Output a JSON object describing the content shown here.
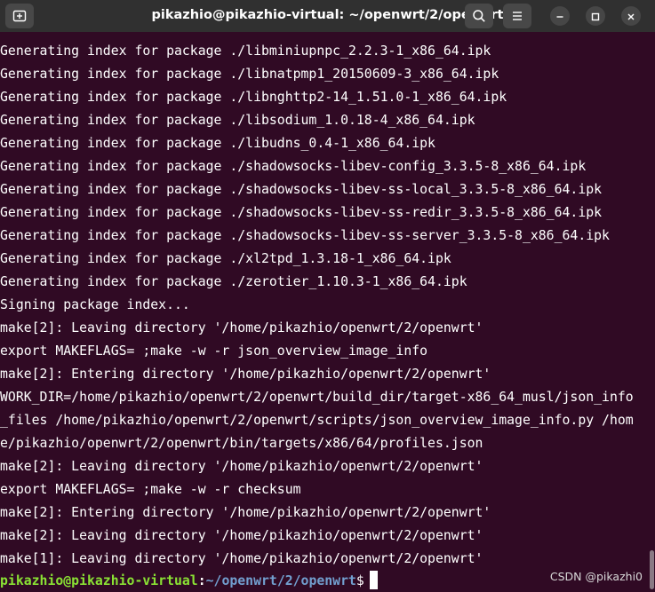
{
  "window": {
    "title": "pikazhio@pikazhio-virtual: ~/openwrt/2/openwrt"
  },
  "toolbar": {
    "new_tab_icon": "new-tab-icon",
    "search_icon": "search-icon",
    "menu_icon": "hamburger-menu-icon"
  },
  "window_controls": {
    "minimize_icon": "minimize-icon",
    "maximize_icon": "maximize-icon",
    "close_icon": "close-icon"
  },
  "terminal": {
    "lines": [
      "Generating index for package ./libminiupnpc_2.2.3-1_x86_64.ipk",
      "Generating index for package ./libnatpmp1_20150609-3_x86_64.ipk",
      "Generating index for package ./libnghttp2-14_1.51.0-1_x86_64.ipk",
      "Generating index for package ./libsodium_1.0.18-4_x86_64.ipk",
      "Generating index for package ./libudns_0.4-1_x86_64.ipk",
      "Generating index for package ./shadowsocks-libev-config_3.3.5-8_x86_64.ipk",
      "Generating index for package ./shadowsocks-libev-ss-local_3.3.5-8_x86_64.ipk",
      "Generating index for package ./shadowsocks-libev-ss-redir_3.3.5-8_x86_64.ipk",
      "Generating index for package ./shadowsocks-libev-ss-server_3.3.5-8_x86_64.ipk",
      "Generating index for package ./xl2tpd_1.3.18-1_x86_64.ipk",
      "Generating index for package ./zerotier_1.10.3-1_x86_64.ipk",
      "Signing package index...",
      "make[2]: Leaving directory '/home/pikazhio/openwrt/2/openwrt'",
      "export MAKEFLAGS= ;make -w -r json_overview_image_info",
      "make[2]: Entering directory '/home/pikazhio/openwrt/2/openwrt'",
      "WORK_DIR=/home/pikazhio/openwrt/2/openwrt/build_dir/target-x86_64_musl/json_info",
      "_files /home/pikazhio/openwrt/2/openwrt/scripts/json_overview_image_info.py /hom",
      "e/pikazhio/openwrt/2/openwrt/bin/targets/x86/64/profiles.json",
      "make[2]: Leaving directory '/home/pikazhio/openwrt/2/openwrt'",
      "export MAKEFLAGS= ;make -w -r checksum",
      "make[2]: Entering directory '/home/pikazhio/openwrt/2/openwrt'",
      "make[2]: Leaving directory '/home/pikazhio/openwrt/2/openwrt'",
      "make[1]: Leaving directory '/home/pikazhio/openwrt/2/openwrt'"
    ],
    "prompt": {
      "user_host": "pikazhio@pikazhio-virtual",
      "separator": ":",
      "path": "~/openwrt/2/openwrt",
      "symbol": "$"
    }
  },
  "watermark": "CSDN @pikazhi0",
  "colors": {
    "terminal_bg": "#300a24",
    "titlebar_bg": "#303030",
    "prompt_user": "#8ae234",
    "prompt_path": "#729fcf"
  }
}
